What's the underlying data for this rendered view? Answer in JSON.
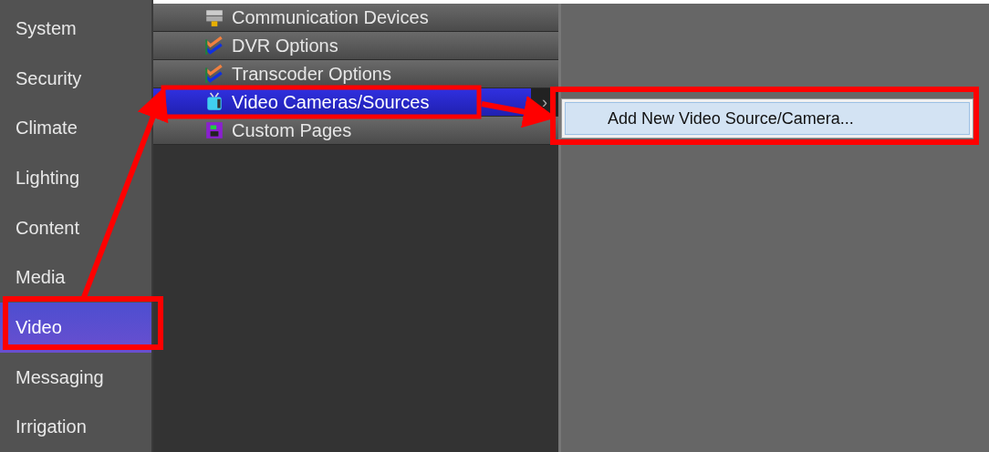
{
  "sidebar": {
    "items": [
      {
        "label": "System",
        "selected": false
      },
      {
        "label": "Security",
        "selected": false
      },
      {
        "label": "Climate",
        "selected": false
      },
      {
        "label": "Lighting",
        "selected": false
      },
      {
        "label": "Content",
        "selected": false
      },
      {
        "label": "Media",
        "selected": false
      },
      {
        "label": "Video",
        "selected": true
      },
      {
        "label": "Messaging",
        "selected": false
      },
      {
        "label": "Irrigation",
        "selected": false
      }
    ]
  },
  "menu": {
    "items": [
      {
        "label": "Communication Devices",
        "kind": "devices",
        "selected": false,
        "submenu": false
      },
      {
        "label": "DVR Options",
        "kind": "checks",
        "selected": false,
        "submenu": false
      },
      {
        "label": "Transcoder Options",
        "kind": "checks",
        "selected": false,
        "submenu": false
      },
      {
        "label": "Video Cameras/Sources",
        "kind": "tv",
        "selected": true,
        "submenu": true
      },
      {
        "label": "Custom Pages",
        "kind": "pages",
        "selected": false,
        "submenu": false
      }
    ],
    "submenu_arrow": "›"
  },
  "context_menu": {
    "items": [
      {
        "label": "Add New Video Source/Camera...",
        "selected": true
      }
    ]
  }
}
